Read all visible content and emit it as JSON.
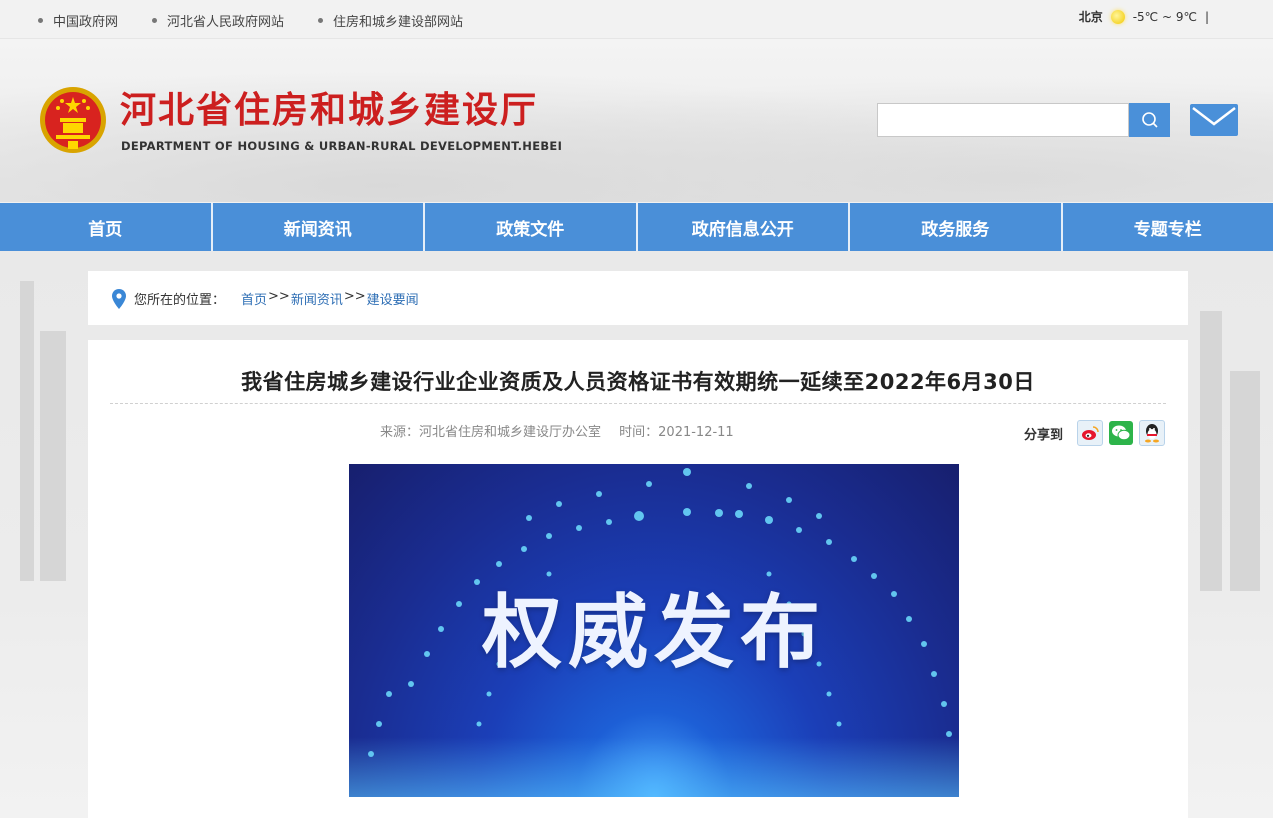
{
  "topbar": {
    "links": [
      "中国政府网",
      "河北省人民政府网站",
      "住房和城乡建设部网站"
    ],
    "weather": {
      "city": "北京",
      "temp": "-5℃ ~ 9℃",
      "divider": "|"
    }
  },
  "header": {
    "title": "河北省住房和城乡建设厅",
    "subtitle": "DEPARTMENT OF HOUSING & URBAN-RURAL DEVELOPMENT.HEBEI",
    "search_placeholder": ""
  },
  "nav": {
    "items": [
      "首页",
      "新闻资讯",
      "政策文件",
      "政府信息公开",
      "政务服务",
      "专题专栏"
    ]
  },
  "breadcrumb": {
    "label": "您所在的位置：",
    "items": [
      "首页",
      "新闻资讯",
      "建设要闻"
    ],
    "separator": ">>"
  },
  "article": {
    "title": "我省住房城乡建设行业企业资质及人员资格证书有效期统一延续至2022年6月30日",
    "source": "来源：河北省住房和城乡建设厅办公室",
    "time": "时间：2021-12-11",
    "share_label": "分享到",
    "banner_text": "权威发布"
  },
  "colors": {
    "nav_bg": "#4a8fd8",
    "title_red": "#cc1f1f",
    "link_blue": "#2f6fb5"
  },
  "icons": [
    "sun-icon",
    "emblem-icon",
    "search-icon",
    "mail-icon",
    "location-pin-icon",
    "weibo-icon",
    "wechat-icon",
    "qq-icon"
  ]
}
